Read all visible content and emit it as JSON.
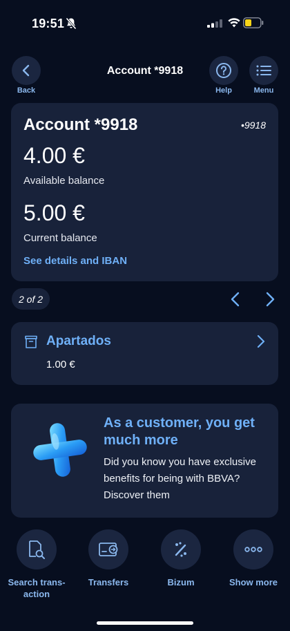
{
  "status_bar": {
    "time": "19:51"
  },
  "header": {
    "title": "Account *9918",
    "back_label": "Back",
    "help_label": "Help",
    "menu_label": "Menu"
  },
  "account": {
    "title": "Account *9918",
    "masked_number": "•9918",
    "available_amount": "4.00 €",
    "available_label": "Available balance",
    "current_amount": "5.00 €",
    "current_label": "Current balance",
    "details_link": "See details and IBAN"
  },
  "pager": {
    "label": "2 of 2"
  },
  "apartados": {
    "title": "Apartados",
    "amount": "1.00 €"
  },
  "promo": {
    "title": "As a customer, you get much more",
    "text": "Did you know you have exclusive benefits for being with BBVA? Discover them"
  },
  "actions": [
    {
      "label": "Search trans-action",
      "icon": "search-document-icon"
    },
    {
      "label": "Transfers",
      "icon": "transfer-icon"
    },
    {
      "label": "Bizum",
      "icon": "bizum-icon"
    },
    {
      "label": "Show more",
      "icon": "more-icon"
    }
  ],
  "colors": {
    "background": "#070e1f",
    "card": "#18223a",
    "accent": "#6fb0f7",
    "caption": "#8bb8ee"
  }
}
